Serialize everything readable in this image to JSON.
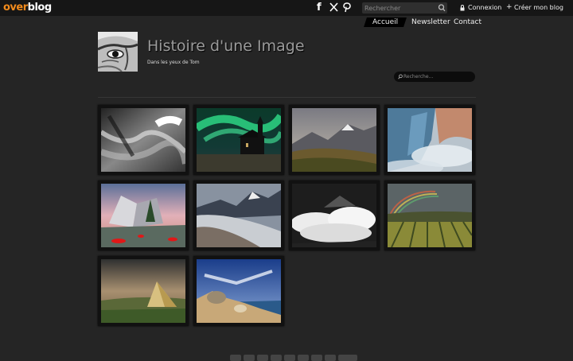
{
  "topbar": {
    "logo_over": "over",
    "logo_blog": "blog",
    "social": [
      "facebook-icon",
      "x-icon",
      "pinterest-icon"
    ],
    "search_placeholder": "Rechercher",
    "login_label": "Connexion",
    "create_blog_label": "Créer mon blog"
  },
  "nav": {
    "items": [
      {
        "label": "Accueil",
        "active": true
      },
      {
        "label": "Newsletter",
        "active": false
      },
      {
        "label": "Contact",
        "active": false
      }
    ]
  },
  "blog": {
    "title": "Histoire d'une Image",
    "subtitle": "Dans les yeux de Tom",
    "search_placeholder": "Recherche..."
  },
  "gallery": {
    "photos": [
      "abstract-blur-bw",
      "aurora-church",
      "mountain-valley",
      "misty-cliffs",
      "modern-building-tree",
      "snowy-mountain-slope",
      "clouds-bw",
      "rainbow-vineyard",
      "haystack-field",
      "rocky-coast"
    ]
  },
  "colors": {
    "brand_orange": "#f08a1c",
    "background": "#252525",
    "topbar": "#161616"
  }
}
